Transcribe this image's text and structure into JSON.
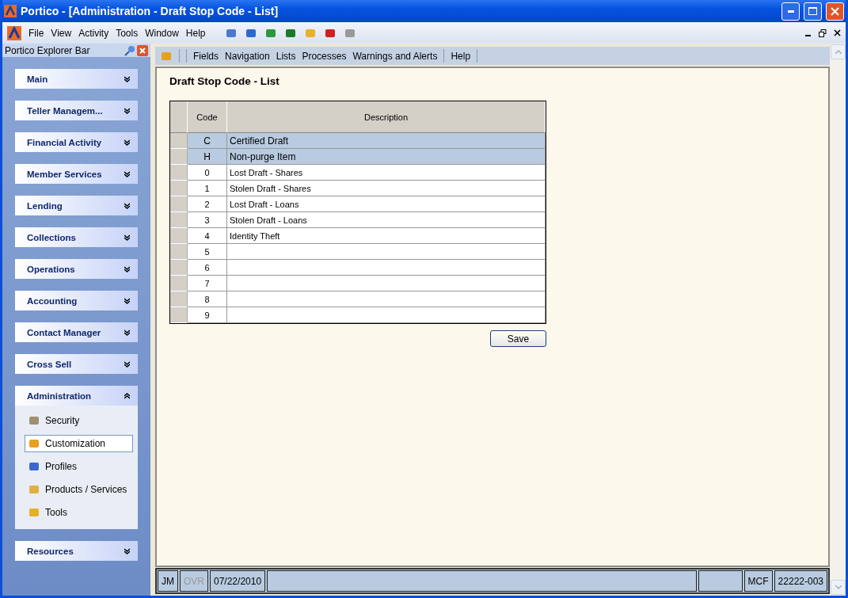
{
  "window": {
    "title": "Portico - [Administration - Draft Stop Code - List]"
  },
  "menu": [
    "File",
    "View",
    "Activity",
    "Tools",
    "Window",
    "Help"
  ],
  "explorer": {
    "title": "Portico Explorer Bar",
    "sections": [
      {
        "label": "Main",
        "expanded": false
      },
      {
        "label": "Teller Managem...",
        "expanded": false
      },
      {
        "label": "Financial Activity",
        "expanded": false
      },
      {
        "label": "Member Services",
        "expanded": false
      },
      {
        "label": "Lending",
        "expanded": false
      },
      {
        "label": "Collections",
        "expanded": false
      },
      {
        "label": "Operations",
        "expanded": false
      },
      {
        "label": "Accounting",
        "expanded": false
      },
      {
        "label": "Contact Manager",
        "expanded": false
      },
      {
        "label": "Cross Sell",
        "expanded": false
      },
      {
        "label": "Administration",
        "expanded": true,
        "items": [
          {
            "label": "Security",
            "selected": false
          },
          {
            "label": "Customization",
            "selected": true
          },
          {
            "label": "Profiles",
            "selected": false
          },
          {
            "label": "Products / Services",
            "selected": false
          },
          {
            "label": "Tools",
            "selected": false
          }
        ]
      },
      {
        "label": "Resources",
        "expanded": false
      }
    ]
  },
  "toolbar": {
    "groups": [
      [
        "Fields",
        "Navigation",
        "Lists",
        "Processes",
        "Warnings and Alerts"
      ],
      [
        "Help"
      ]
    ]
  },
  "page": {
    "title": "Draft Stop Code - List",
    "table": {
      "columns": [
        "Code",
        "Description"
      ],
      "rows": [
        {
          "code": "C",
          "description": "Certified Draft",
          "selected": true
        },
        {
          "code": "H",
          "description": "Non-purge Item",
          "selected": true
        },
        {
          "code": "0",
          "description": "Lost Draft - Shares",
          "selected": false
        },
        {
          "code": "1",
          "description": "Stolen Draft - Shares",
          "selected": false
        },
        {
          "code": "2",
          "description": "Lost Draft - Loans",
          "selected": false
        },
        {
          "code": "3",
          "description": "Stolen Draft - Loans",
          "selected": false
        },
        {
          "code": "4",
          "description": "Identity Theft",
          "selected": false
        },
        {
          "code": "5",
          "selected": false
        },
        {
          "code": "6",
          "selected": false
        },
        {
          "code": "7",
          "selected": false
        },
        {
          "code": "8",
          "selected": false
        },
        {
          "code": "9",
          "selected": false
        }
      ]
    },
    "save_button": "Save"
  },
  "status_bar": [
    {
      "text": "JM",
      "disabled": false
    },
    {
      "text": "OVR",
      "disabled": true
    },
    {
      "text": "07/22/2010",
      "disabled": false
    },
    {
      "kind": "wide"
    },
    {
      "kind": "blank"
    },
    {
      "text": "MCF",
      "disabled": false
    },
    {
      "text": "22222-003",
      "disabled": false
    }
  ]
}
